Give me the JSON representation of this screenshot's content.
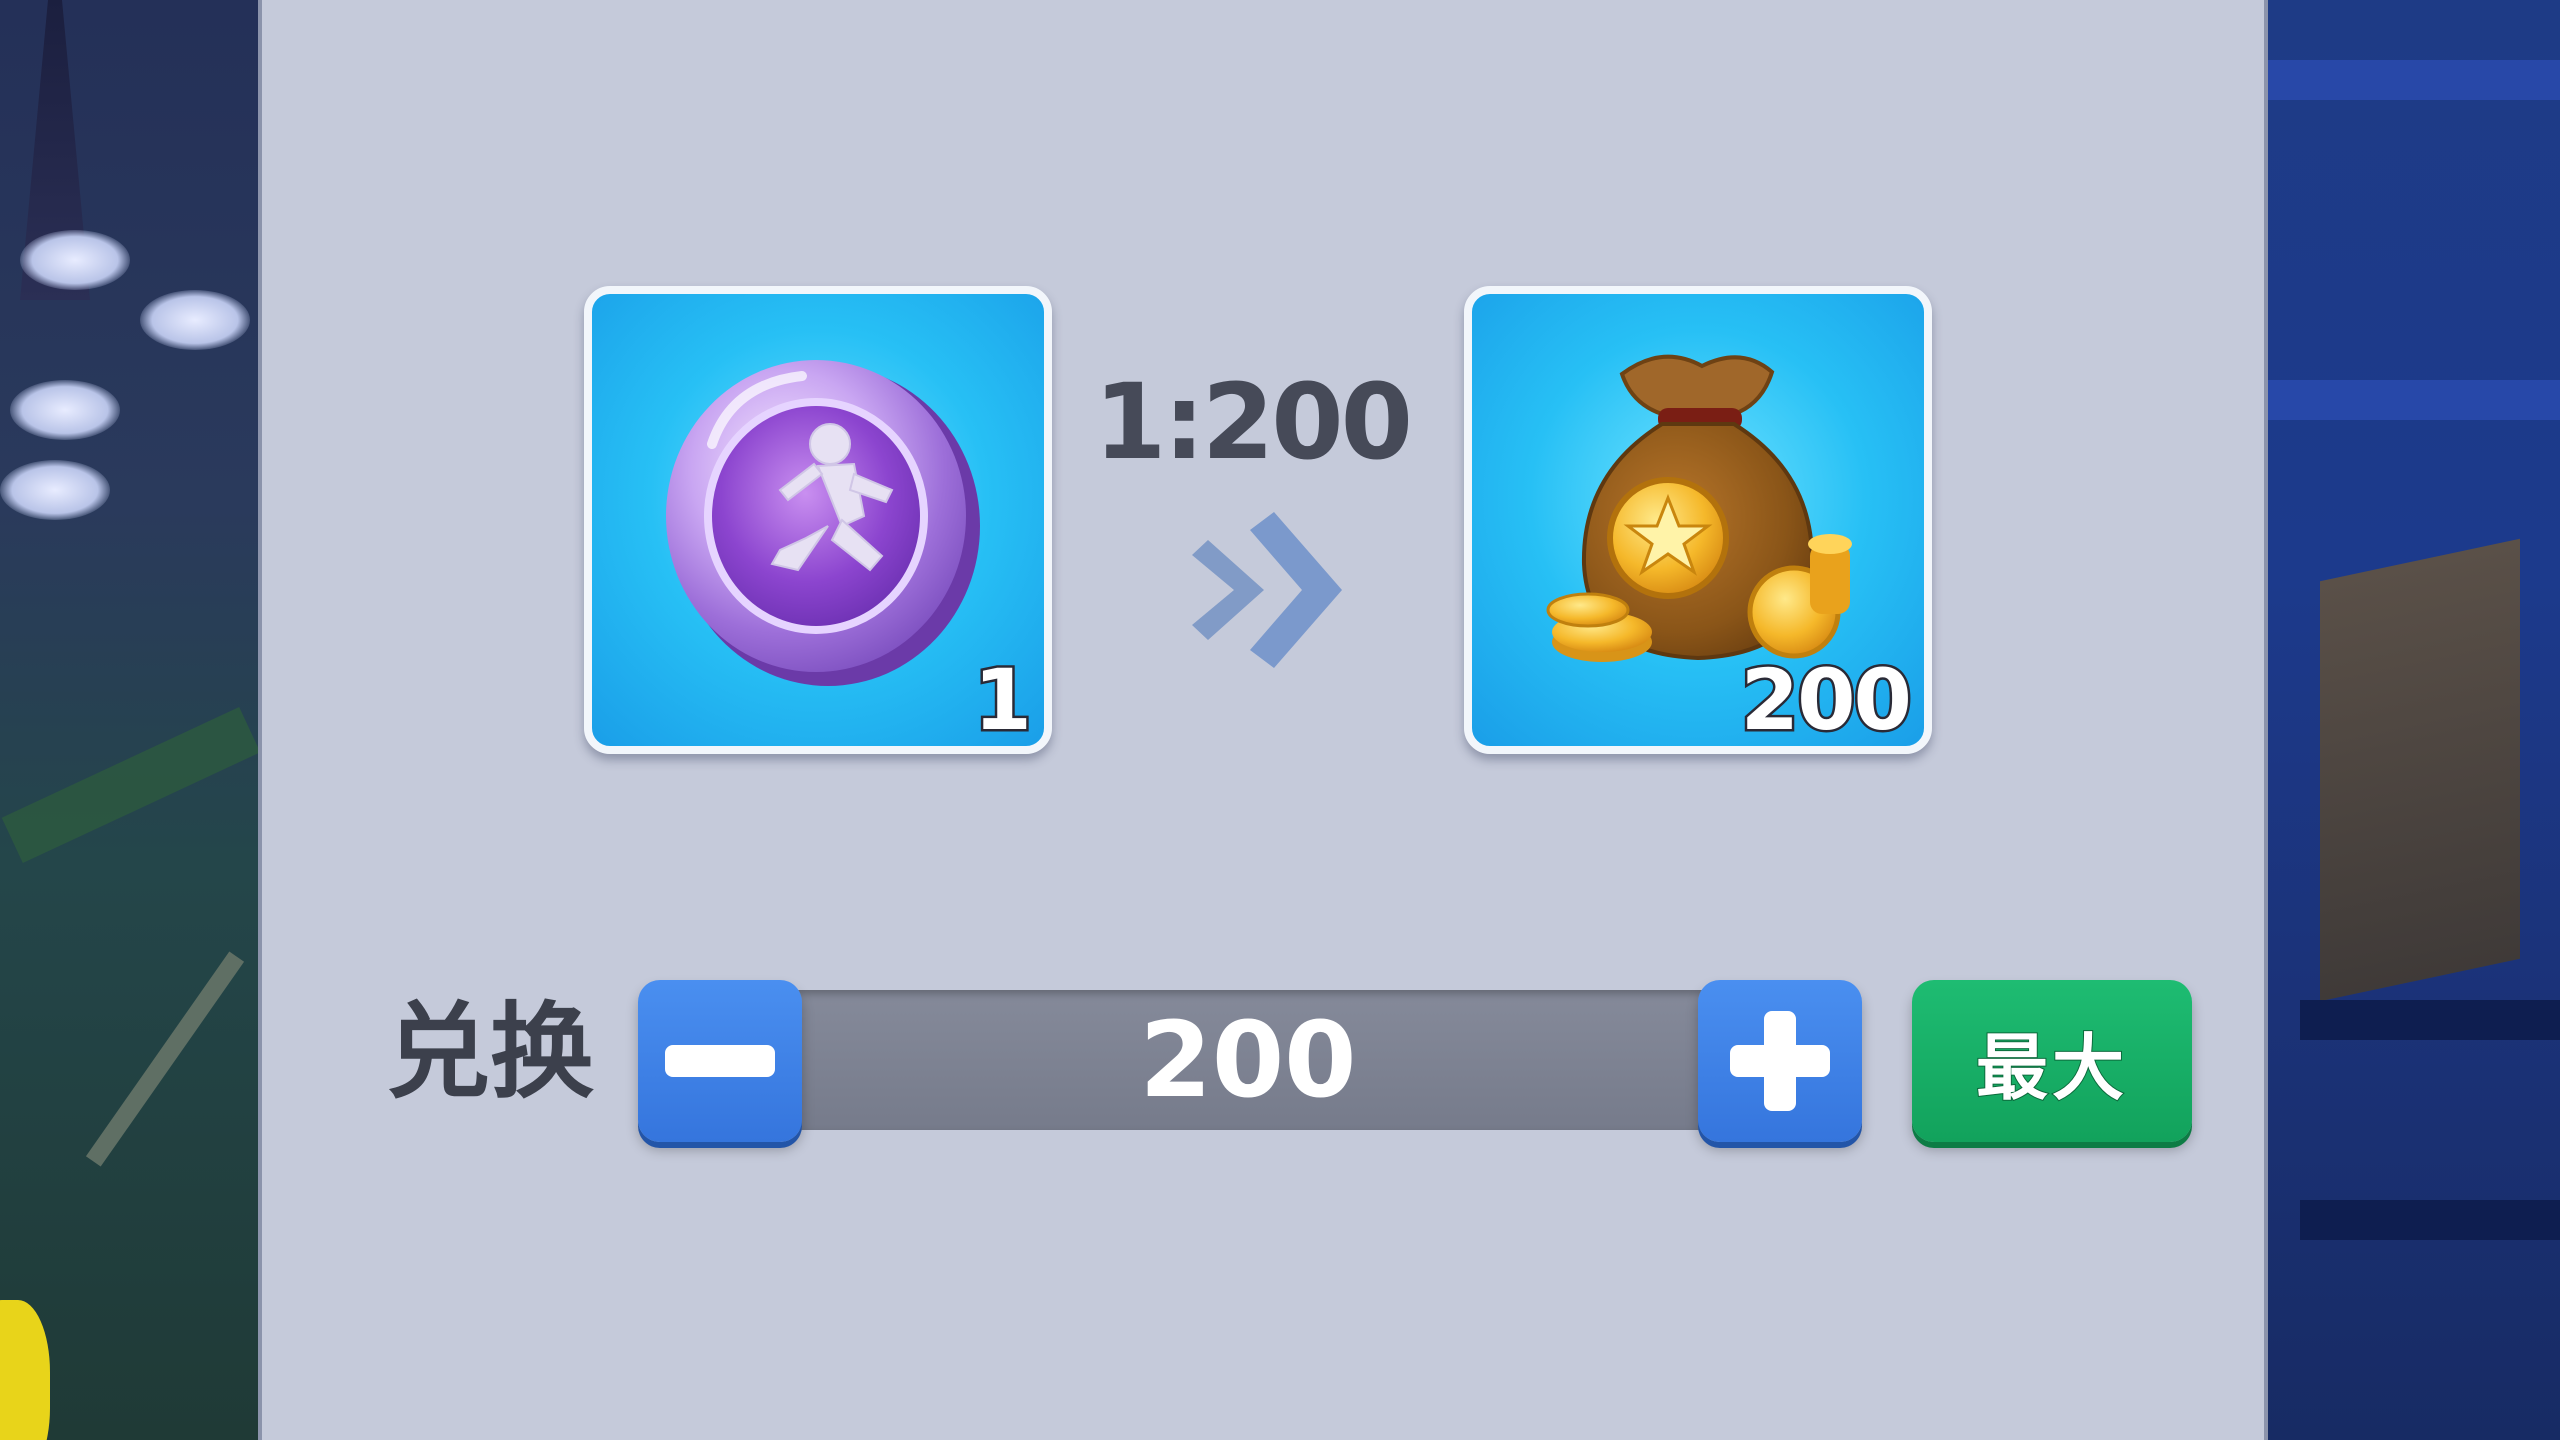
{
  "exchange": {
    "ratio_text": "1:200",
    "from_item": {
      "name_icon": "runner-medal-icon",
      "quantity": "1"
    },
    "to_item": {
      "name_icon": "coin-bag-icon",
      "quantity": "200"
    },
    "label": "兑换",
    "amount": "200",
    "max_label": "最大"
  },
  "colors": {
    "panel": "#c5cada",
    "card_blue": "#27c0f5",
    "stepper_blue": "#3f84e8",
    "max_green": "#17b068",
    "ratio_text": "#464a58"
  }
}
